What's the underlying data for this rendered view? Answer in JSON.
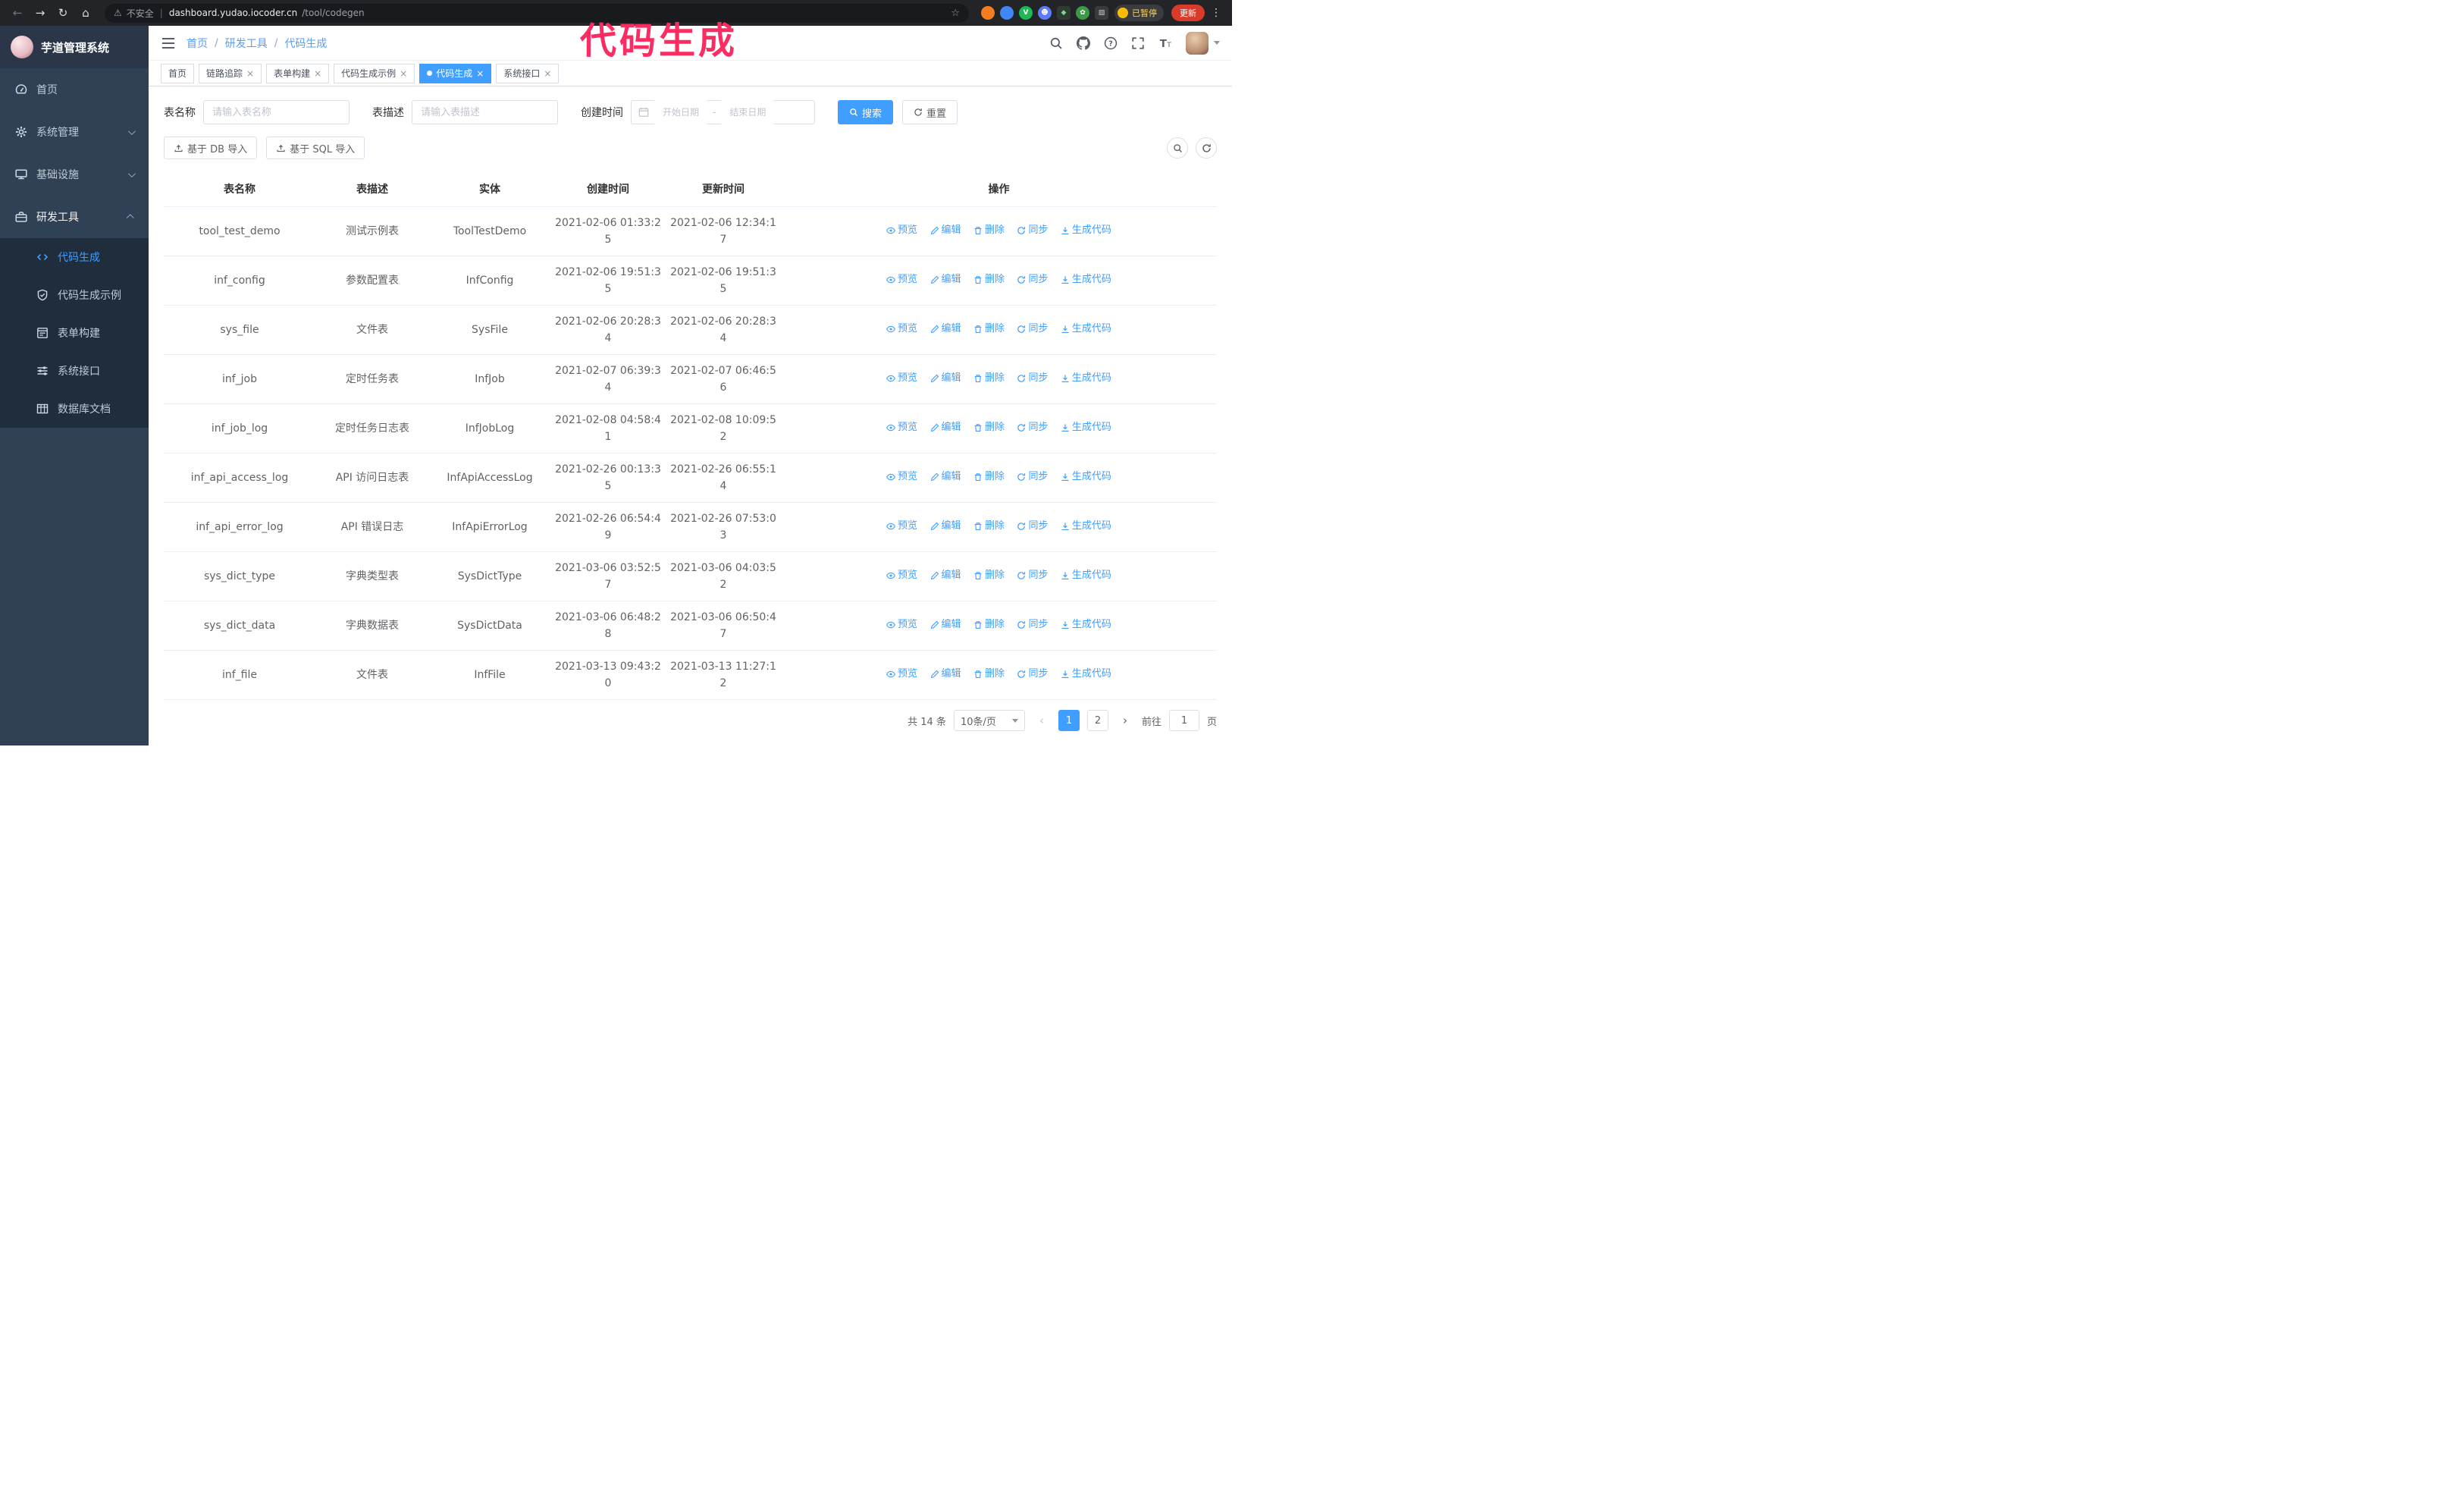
{
  "annotation": "代码生成",
  "browser": {
    "nav_icons": [
      "back-arrow-icon",
      "forward-arrow-icon",
      "reload-icon",
      "home-icon"
    ],
    "security_label": "不安全",
    "url_domain": "dashboard.yudao.iocoder.cn",
    "url_path": "/tool/codegen",
    "star_icon": "bookmark-star-icon",
    "extension_icons": [
      "extension-orange-icon",
      "extension-blue-icon",
      "extension-green-v-icon",
      "extension-people-icon",
      "extension-dark-icon",
      "extension-leaf-icon",
      "puzzle-icon"
    ],
    "paused_badge": "已暂停",
    "update_button": "更新"
  },
  "sidebar": {
    "logo_title": "芋道管理系统",
    "items": [
      {
        "label": "首页",
        "icon": "dashboard-icon"
      },
      {
        "label": "系统管理",
        "icon": "gear-icon",
        "chevron": "down"
      },
      {
        "label": "基础设施",
        "icon": "monitor-icon",
        "chevron": "down"
      },
      {
        "label": "研发工具",
        "icon": "toolbox-icon",
        "chevron": "up",
        "expanded": true
      }
    ],
    "subitems": [
      {
        "label": "代码生成",
        "icon": "code-icon",
        "active": true
      },
      {
        "label": "代码生成示例",
        "icon": "shield-check-icon"
      },
      {
        "label": "表单构建",
        "icon": "form-icon"
      },
      {
        "label": "系统接口",
        "icon": "sliders-icon"
      },
      {
        "label": "数据库文档",
        "icon": "table-grid-icon"
      }
    ]
  },
  "header": {
    "breadcrumb": [
      "首页",
      "研发工具",
      "代码生成"
    ],
    "right_icons": [
      "search-icon",
      "github-icon",
      "help-icon",
      "fullscreen-icon",
      "font-size-icon",
      "avatar"
    ]
  },
  "tabs": [
    {
      "label": "首页",
      "closable": false,
      "active": false
    },
    {
      "label": "链路追踪",
      "closable": true,
      "active": false
    },
    {
      "label": "表单构建",
      "closable": true,
      "active": false
    },
    {
      "label": "代码生成示例",
      "closable": true,
      "active": false
    },
    {
      "label": "代码生成",
      "closable": true,
      "active": true
    },
    {
      "label": "系统接口",
      "closable": true,
      "active": false
    }
  ],
  "filters": {
    "table_name_label": "表名称",
    "table_name_placeholder": "请输入表名称",
    "table_desc_label": "表描述",
    "table_desc_placeholder": "请输入表描述",
    "create_time_label": "创建时间",
    "date_start_placeholder": "开始日期",
    "date_separator": "-",
    "date_end_placeholder": "结束日期",
    "search_button": "搜索",
    "reset_button": "重置"
  },
  "toolbar": {
    "import_db": "基于 DB 导入",
    "import_sql": "基于 SQL 导入",
    "circle_icons": [
      "search-toggle-icon",
      "refresh-icon"
    ]
  },
  "table": {
    "columns": [
      "表名称",
      "表描述",
      "实体",
      "创建时间",
      "更新时间",
      "操作"
    ],
    "actions": [
      "预览",
      "编辑",
      "删除",
      "同步",
      "生成代码"
    ],
    "rows": [
      {
        "name": "tool_test_demo",
        "desc": "测试示例表",
        "entity": "ToolTestDemo",
        "created": "2021-02-06 01:33:25",
        "updated": "2021-02-06 12:34:17"
      },
      {
        "name": "inf_config",
        "desc": "参数配置表",
        "entity": "InfConfig",
        "created": "2021-02-06 19:51:35",
        "updated": "2021-02-06 19:51:35"
      },
      {
        "name": "sys_file",
        "desc": "文件表",
        "entity": "SysFile",
        "created": "2021-02-06 20:28:34",
        "updated": "2021-02-06 20:28:34"
      },
      {
        "name": "inf_job",
        "desc": "定时任务表",
        "entity": "InfJob",
        "created": "2021-02-07 06:39:34",
        "updated": "2021-02-07 06:46:56"
      },
      {
        "name": "inf_job_log",
        "desc": "定时任务日志表",
        "entity": "InfJobLog",
        "created": "2021-02-08 04:58:41",
        "updated": "2021-02-08 10:09:52"
      },
      {
        "name": "inf_api_access_log",
        "desc": "API 访问日志表",
        "entity": "InfApiAccessLog",
        "created": "2021-02-26 00:13:35",
        "updated": "2021-02-26 06:55:14"
      },
      {
        "name": "inf_api_error_log",
        "desc": "API 错误日志",
        "entity": "InfApiErrorLog",
        "created": "2021-02-26 06:54:49",
        "updated": "2021-02-26 07:53:03"
      },
      {
        "name": "sys_dict_type",
        "desc": "字典类型表",
        "entity": "SysDictType",
        "created": "2021-03-06 03:52:57",
        "updated": "2021-03-06 04:03:52"
      },
      {
        "name": "sys_dict_data",
        "desc": "字典数据表",
        "entity": "SysDictData",
        "created": "2021-03-06 06:48:28",
        "updated": "2021-03-06 06:50:47"
      },
      {
        "name": "inf_file",
        "desc": "文件表",
        "entity": "InfFile",
        "created": "2021-03-13 09:43:20",
        "updated": "2021-03-13 11:27:12"
      }
    ]
  },
  "pagination": {
    "total_label": "共 14 条",
    "page_size": "10条/页",
    "pages": [
      {
        "label": "1",
        "active": true
      },
      {
        "label": "2",
        "active": false
      }
    ],
    "goto_label": "前往",
    "goto_value": "1",
    "unit_label": "页"
  },
  "colors": {
    "accent": "#409eff",
    "annotation": "#fa2c62",
    "sidebar_bg": "#304156",
    "submenu_bg": "#1f2d3d",
    "update_button_bg": "#d93b2b"
  }
}
